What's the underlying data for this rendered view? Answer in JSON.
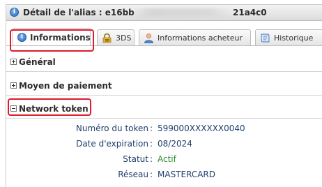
{
  "window": {
    "title_prefix": "Détail de l'alias : e16bb",
    "title_suffix": "21a4c0"
  },
  "tabs": [
    {
      "label": "Informations",
      "icon": "info-icon",
      "active": true
    },
    {
      "label": "3DS",
      "icon": "lock-3ds-icon",
      "active": false
    },
    {
      "label": "Informations acheteur",
      "icon": "user-icon",
      "active": false
    },
    {
      "label": "Historique",
      "icon": "history-icon",
      "active": false
    }
  ],
  "sections": {
    "general": {
      "label": "Général",
      "expanded": false
    },
    "payment": {
      "label": "Moyen de paiement",
      "expanded": false
    },
    "network_token": {
      "label": "Network token",
      "expanded": true
    }
  },
  "network_token": {
    "fields": [
      {
        "label": "Numéro du token",
        "value": "599000XXXXXX0040"
      },
      {
        "label": "Date d'expiration",
        "value": "08/2024"
      },
      {
        "label": "Statut",
        "value": "Actif"
      },
      {
        "label": "Réseau",
        "value": "MASTERCARD"
      }
    ]
  },
  "colors": {
    "highlight": "#e0192b",
    "field_text": "#1f3f6e",
    "status_active": "#2e8b2e"
  }
}
